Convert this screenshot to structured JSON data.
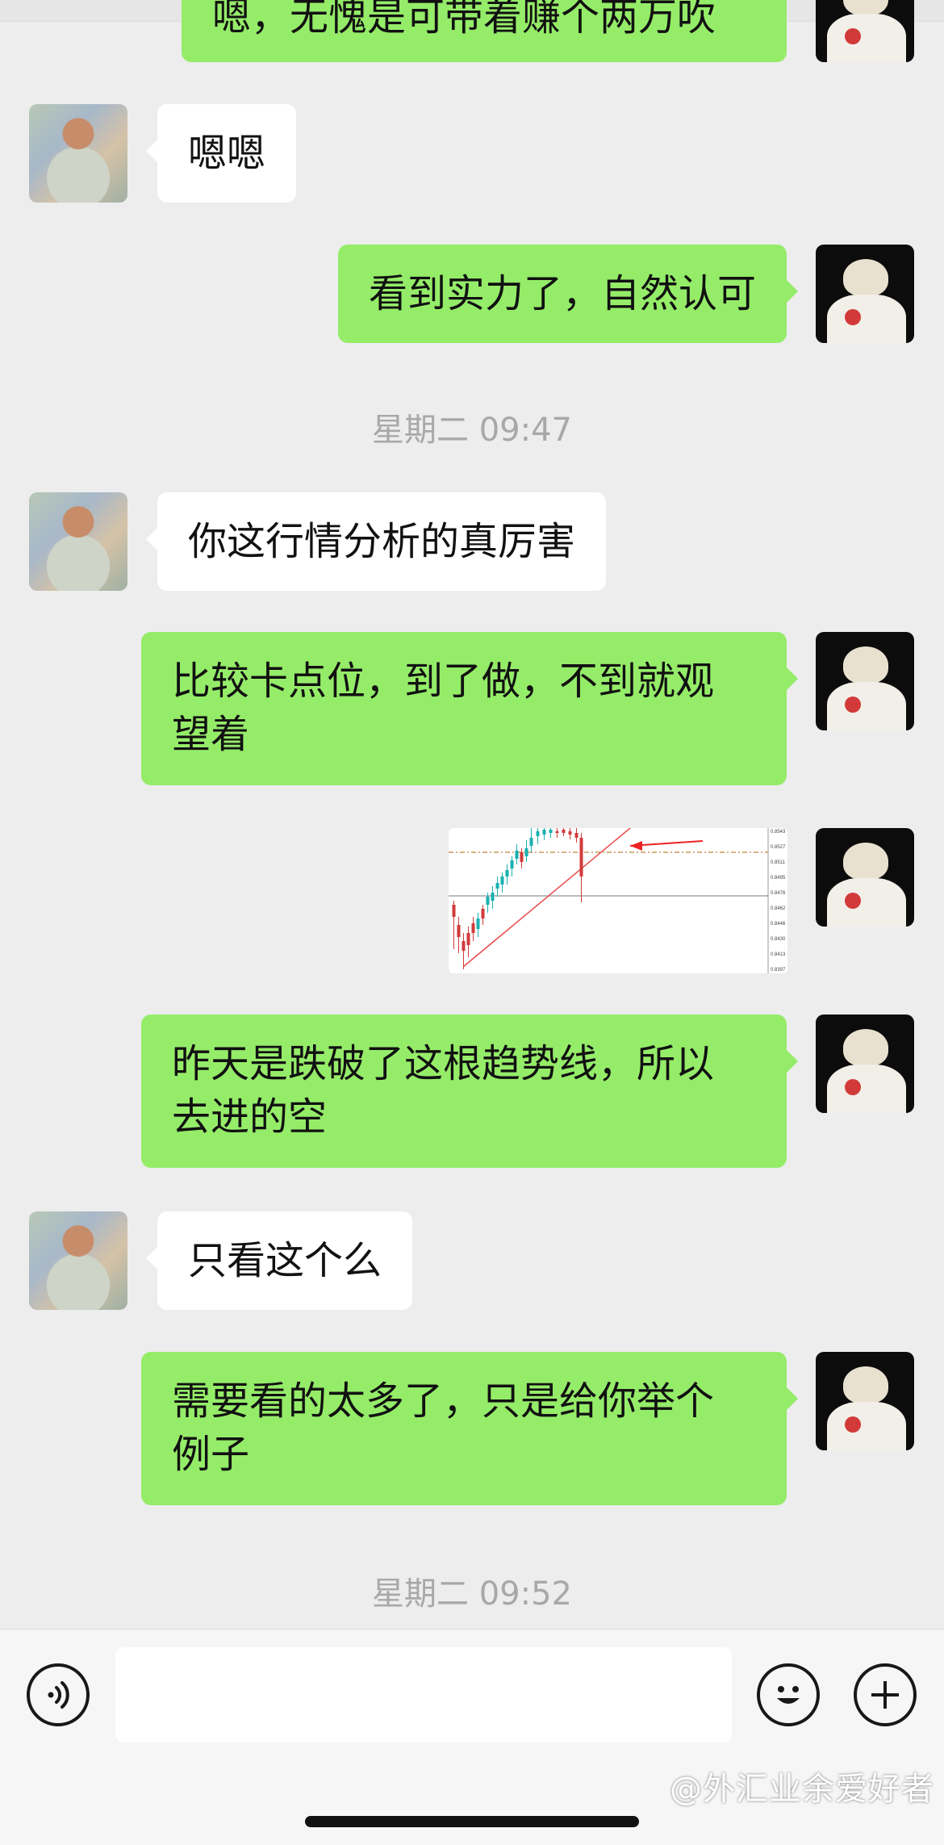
{
  "messages": [
    {
      "side": "right",
      "text": "嗯，无愧是可带着赚个两万吹"
    },
    {
      "side": "left",
      "text": "嗯嗯"
    },
    {
      "side": "right",
      "text": "看到实力了，自然认可"
    },
    {
      "side": "left",
      "text": "你这行情分析的真厉害"
    },
    {
      "side": "right",
      "lines": [
        "比较卡点位，到了做，不到就观",
        "望着"
      ]
    },
    {
      "side": "right",
      "lines": [
        "昨天是跌破了这根趋势线，所以",
        "去进的空"
      ]
    },
    {
      "side": "left",
      "text": "只看这个么"
    },
    {
      "side": "right",
      "lines": [
        "需要看的太多了，只是给你举个",
        "例子"
      ]
    }
  ],
  "timestamps": [
    "星期二 09:47",
    "星期二 09:52"
  ],
  "image_message": {
    "price_labels": [
      "0.8543",
      "0.8527",
      "0.8511",
      "0.8495",
      "0.8476",
      "0.8462",
      "0.8446",
      "0.8430",
      "0.8413",
      "0.8397"
    ]
  },
  "input": {
    "value": "",
    "placeholder": ""
  },
  "icons": {
    "voice": "voice-icon",
    "emoji": "emoji-icon",
    "plus": "plus-icon"
  },
  "watermark": "@外汇业余爱好者",
  "colors": {
    "my_bubble": "#95ec69",
    "their_bubble": "#ffffff",
    "background": "#ededed"
  }
}
